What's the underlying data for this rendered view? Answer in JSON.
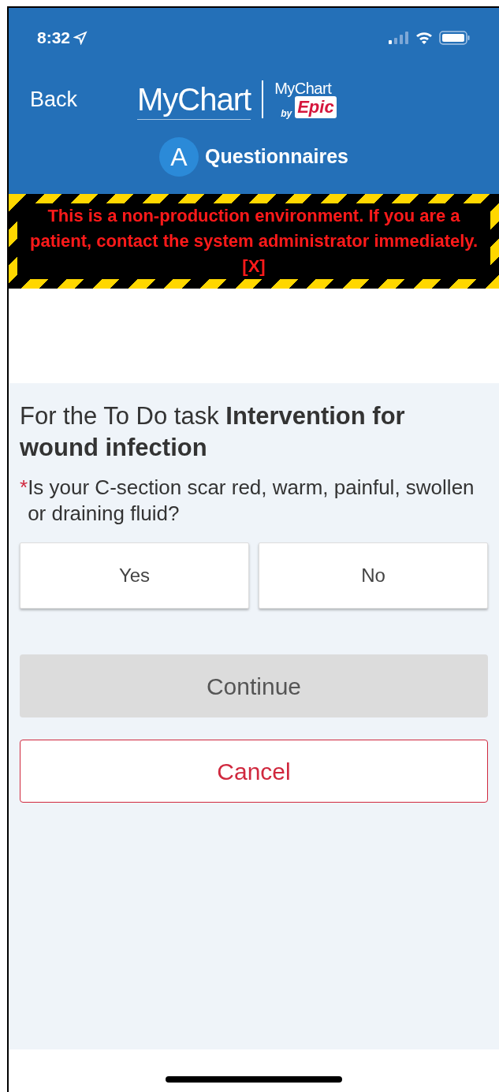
{
  "status_bar": {
    "time": "8:32"
  },
  "header": {
    "back": "Back",
    "logo": "MyChart",
    "brand": {
      "top": "MyChart",
      "by": "by",
      "name": "Epic"
    },
    "avatar": "A",
    "title": "Questionnaires"
  },
  "banner": {
    "text": "This is a non-production environment. If you are a patient, contact the system administrator immediately. [X]"
  },
  "task": {
    "intro": "For the To Do task **Intervention for wound infection**"
  },
  "question": {
    "required": true,
    "mark": "*",
    "text": "Is your C-section scar red, warm, painful, swollen or draining fluid?",
    "options": [
      {
        "label": "Yes",
        "selected": false
      },
      {
        "label": "No",
        "selected": false
      }
    ]
  },
  "continue_button": {
    "label": "Continue",
    "disabled": true
  },
  "cancel_button": {
    "label": "Cancel"
  }
}
